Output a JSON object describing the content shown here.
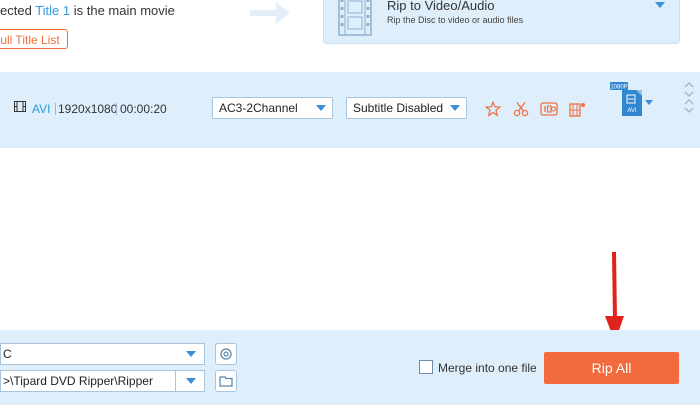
{
  "detected": {
    "prefix": "ected",
    "title_link": "Title 1",
    "suffix": "is the main movie"
  },
  "full_title_list_label": "ull Title List",
  "rip_mode": {
    "title": "Rip to Video/Audio",
    "subtitle": "Rip the Disc to video or audio files"
  },
  "item": {
    "format": "AVI",
    "resolution": "1920x1080",
    "duration": "00:00:20",
    "audio_track": "AC3-2Channel",
    "subtitle": "Subtitle Disabled",
    "output_badge": "1080P",
    "output_ext": "AVI"
  },
  "footer": {
    "output_format_value": "C",
    "save_to_value": ">\\Tipard DVD Ripper\\Ripper",
    "merge_label": "Merge into one file",
    "rip_all_label": "Rip All"
  },
  "colors": {
    "accent_orange": "#f26a3e",
    "panel_blue": "#dfeefb",
    "link_blue": "#2f9be0",
    "annotation_red": "#e0231c"
  }
}
